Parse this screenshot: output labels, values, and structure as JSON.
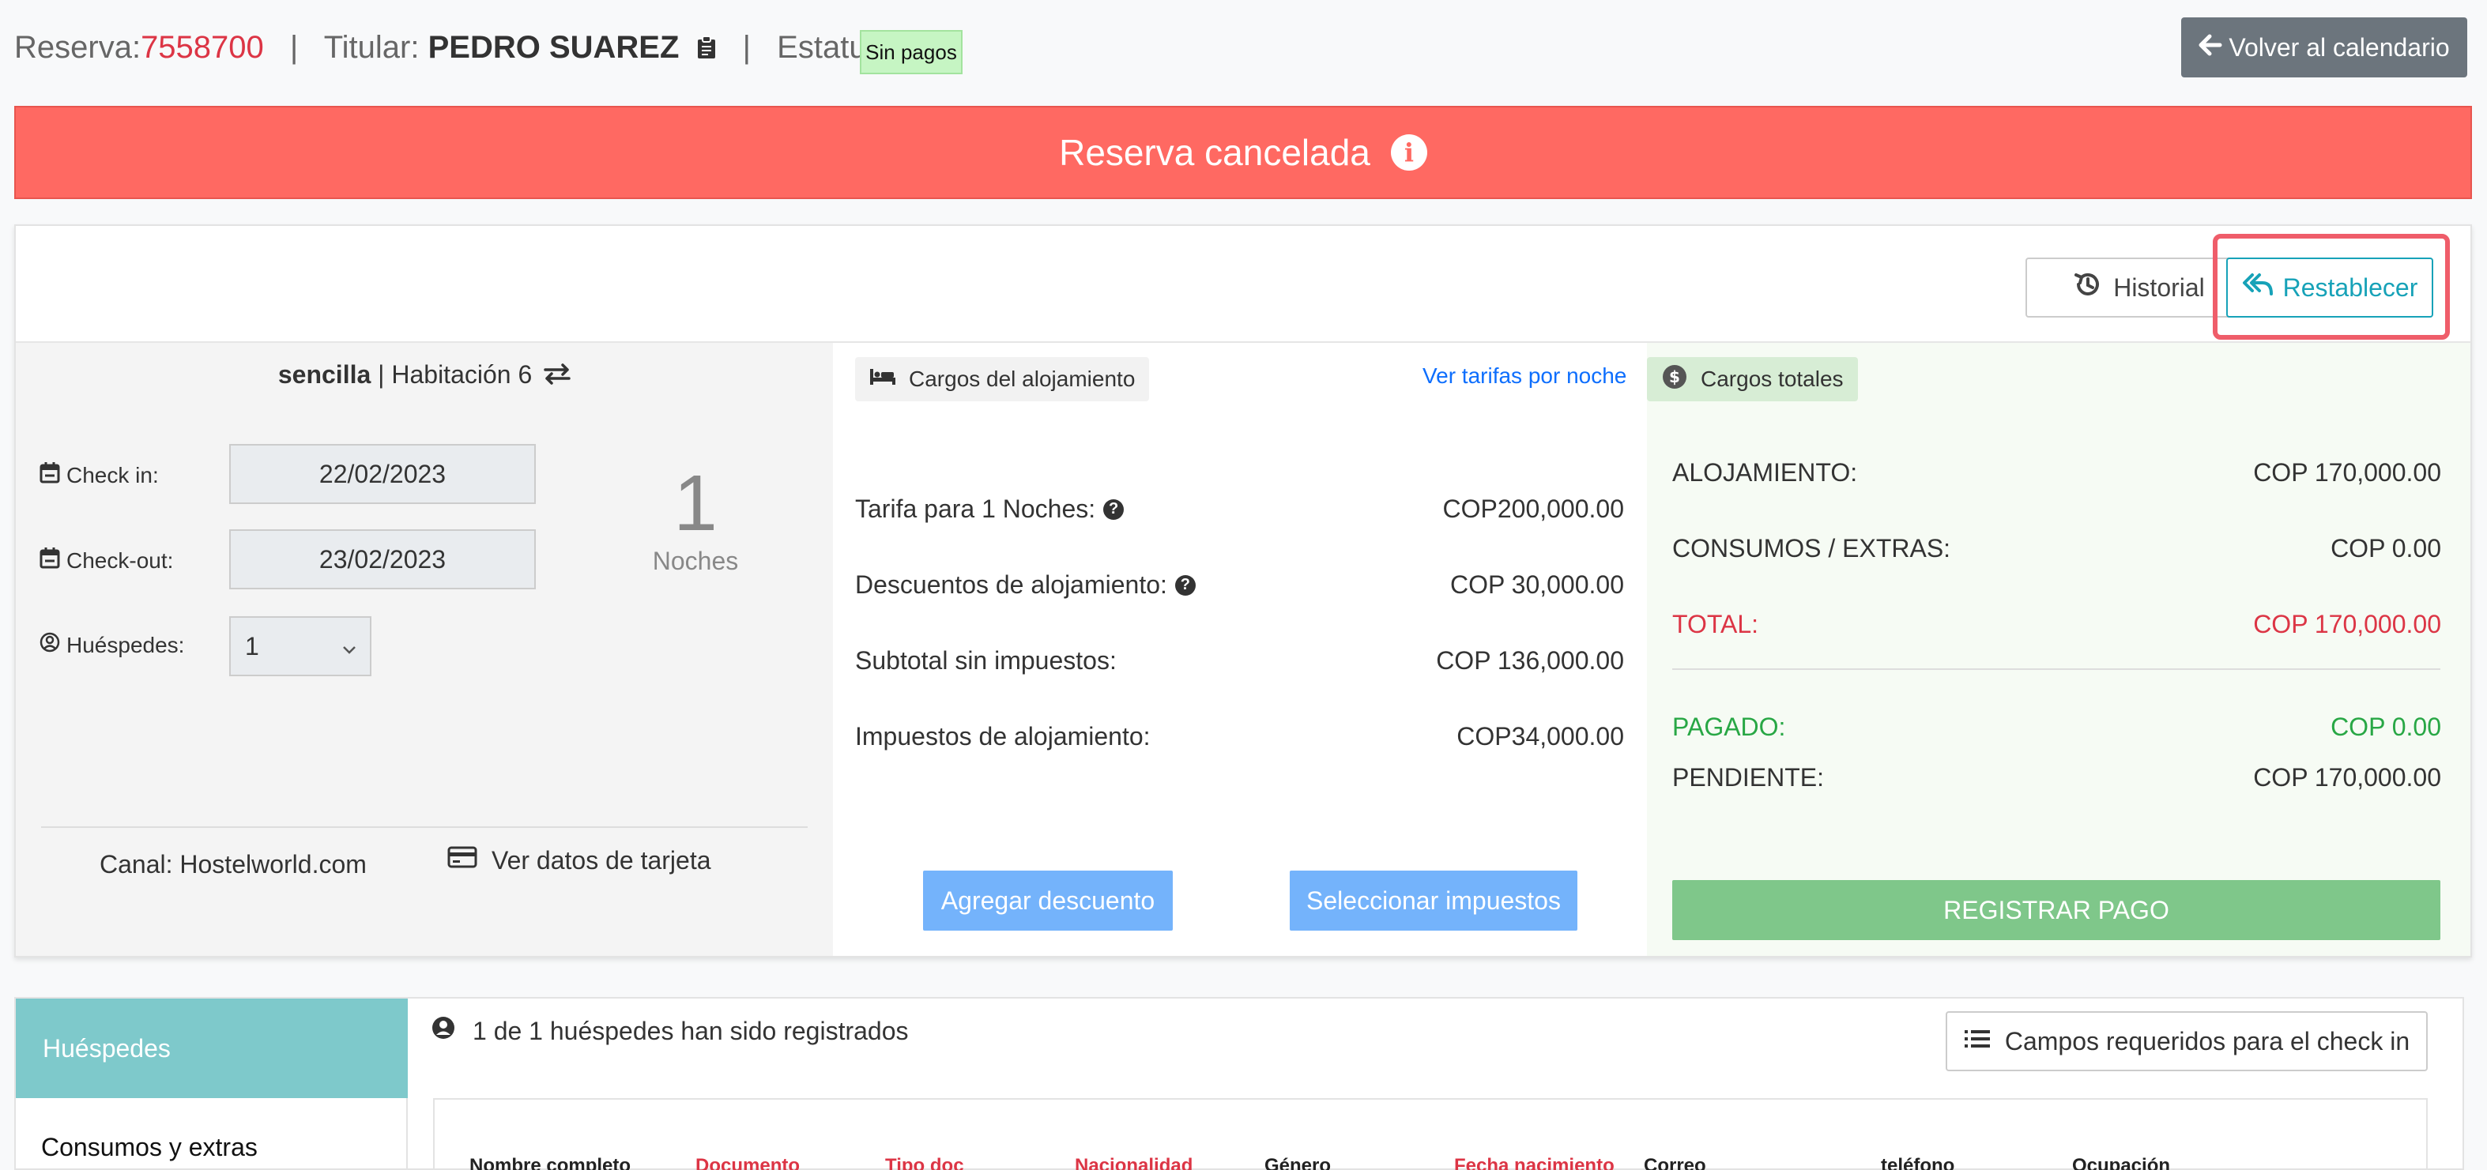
{
  "header": {
    "reserva_label": "Reserva:",
    "reserva_number": "7558700",
    "sep": "|",
    "titular_label": "Titular:",
    "titular_name": "PEDRO SUAREZ",
    "estatus_label": "Estatus:",
    "status_badge": "Sin pagos",
    "back_button": "Volver al calendario"
  },
  "banner": {
    "text": "Reserva cancelada",
    "info_glyph": "i"
  },
  "actions": {
    "historial": "Historial",
    "restablecer": "Restablecer"
  },
  "room": {
    "type": "sencilla",
    "divider": "|",
    "room_label": "Habitación 6",
    "check_in_label": "Check in:",
    "check_in_value": "22/02/2023",
    "check_out_label": "Check-out:",
    "check_out_value": "23/02/2023",
    "guests_label": "Huéspedes:",
    "guests_value": "1",
    "nights_number": "1",
    "nights_label": "Noches",
    "canal": "Canal: Hostelworld.com",
    "card_link": "Ver datos de tarjeta"
  },
  "charges": {
    "title": "Cargos del alojamiento",
    "rates_link": "Ver tarifas por noche",
    "rows": [
      {
        "label": "Tarifa para 1 Noches:",
        "help": true,
        "value": "COP200,000.00"
      },
      {
        "label": "Descuentos de alojamiento:",
        "help": true,
        "value": "COP 30,000.00"
      },
      {
        "label": "Subtotal sin impuestos:",
        "help": false,
        "value": "COP 136,000.00"
      },
      {
        "label": "Impuestos de alojamiento:",
        "help": false,
        "value": "COP34,000.00"
      }
    ],
    "help_glyph": "?",
    "add_discount": "Agregar descuento",
    "select_taxes": "Seleccionar impuestos"
  },
  "totals": {
    "title": "Cargos totales",
    "alojamiento_label": "ALOJAMIENTO:",
    "alojamiento_value": "COP 170,000.00",
    "consumos_label": "CONSUMOS / EXTRAS:",
    "consumos_value": "COP 0.00",
    "total_label": "TOTAL:",
    "total_value": "COP 170,000.00",
    "pagado_label": "PAGADO:",
    "pagado_value": "COP 0.00",
    "pendiente_label": "PENDIENTE:",
    "pendiente_value": "COP 170,000.00",
    "pay_button": "REGISTRAR PAGO"
  },
  "tabs": {
    "active": "Huéspedes",
    "second": "Consumos y extras"
  },
  "guests": {
    "message": "1 de 1 huéspedes han sido registrados",
    "campos_button": "Campos requeridos para el check in",
    "columns": [
      "Nombre completo",
      "Documento",
      "Tipo doc",
      "Nacionalidad",
      "Género",
      "Fecha nacimiento",
      "Correo",
      "teléfono",
      "Ocupación"
    ]
  },
  "colors": {
    "reserva_number": "#dc3545",
    "banner": "#ff6962",
    "restablecer": "#17a2b8",
    "highlight": "#ef5d6a",
    "pay_button": "#7fc78a",
    "tab_active": "#7ec9cb",
    "blue_buttons": "#74b3fb"
  }
}
